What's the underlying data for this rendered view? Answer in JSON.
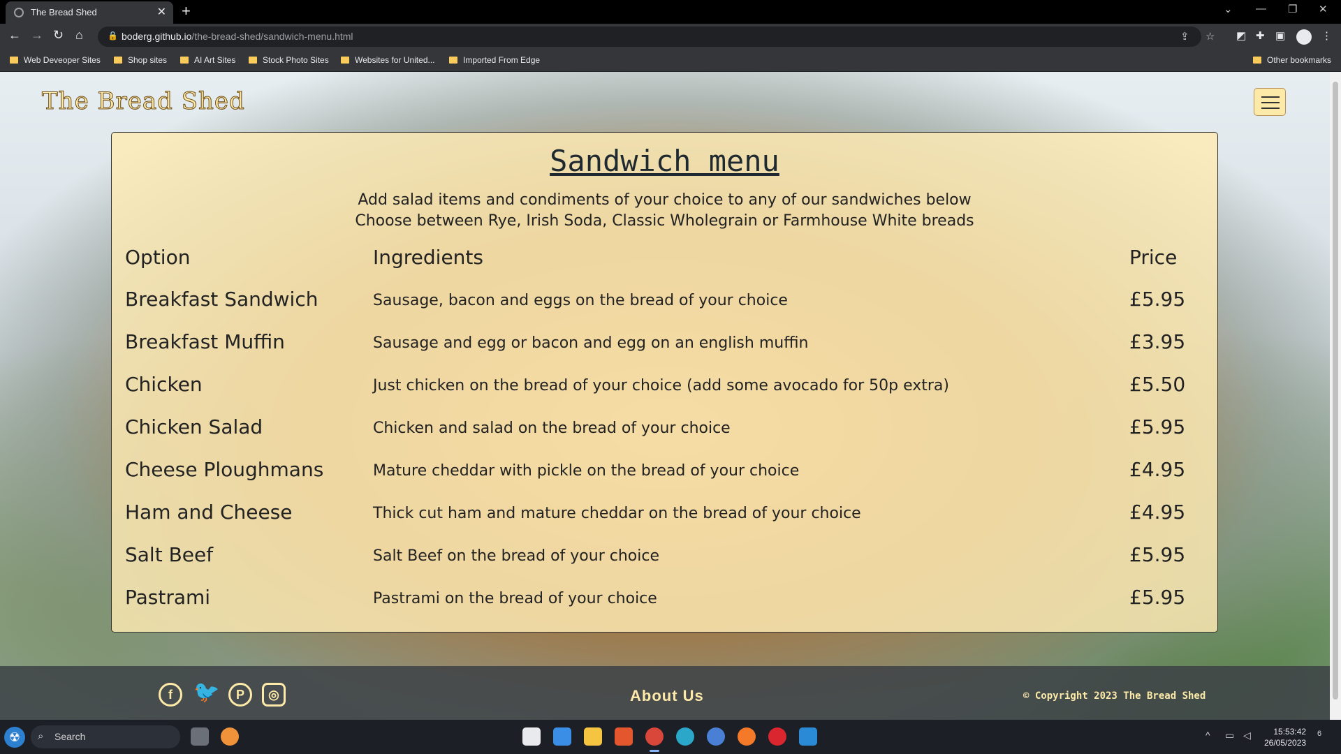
{
  "browser": {
    "tab_title": "The Bread Shed",
    "new_tab": "+",
    "url_host": "boderg.github.io",
    "url_path": "/the-bread-shed/sandwich-menu.html",
    "bookmarks": [
      "Web Deveoper Sites",
      "Shop sites",
      "AI Art Sites",
      "Stock Photo Sites",
      "Websites for United...",
      "Imported From Edge"
    ],
    "other_bookmarks": "Other bookmarks"
  },
  "site": {
    "brand": "The Bread Shed",
    "menu": {
      "title": "Sandwich menu",
      "subtitle_1": "Add salad items and condiments of your choice to any of our sandwiches below",
      "subtitle_2": "Choose between Rye, Irish Soda, Classic Wholegrain or Farmhouse White breads",
      "headers": {
        "option": "Option",
        "ingredients": "Ingredients",
        "price": "Price"
      },
      "rows": [
        {
          "option": "Breakfast Sandwich",
          "ingredients": "Sausage, bacon and eggs on the bread of your choice",
          "price": "£5.95"
        },
        {
          "option": "Breakfast Muffin",
          "ingredients": "Sausage and egg or bacon and egg on an english muffin",
          "price": "£3.95"
        },
        {
          "option": "Chicken",
          "ingredients": "Just chicken on the bread of your choice (add some avocado for 50p extra)",
          "price": "£5.50"
        },
        {
          "option": "Chicken Salad",
          "ingredients": "Chicken and salad on the bread of your choice",
          "price": "£5.95"
        },
        {
          "option": "Cheese Ploughmans",
          "ingredients": "Mature cheddar with pickle on the bread of your choice",
          "price": "£4.95"
        },
        {
          "option": "Ham and Cheese",
          "ingredients": "Thick cut ham and mature cheddar on the bread of your choice",
          "price": "£4.95"
        },
        {
          "option": "Salt Beef",
          "ingredients": "Salt Beef on the bread of your choice",
          "price": "£5.95"
        },
        {
          "option": "Pastrami",
          "ingredients": "Pastrami on the bread of your choice",
          "price": "£5.95"
        }
      ]
    },
    "footer": {
      "social_icons": [
        "facebook-icon",
        "twitter-icon",
        "pinterest-icon",
        "instagram-icon"
      ],
      "about": "About Us",
      "copyright": "© Copyright 2023 The Bread Shed"
    }
  },
  "taskbar": {
    "search_label": "Search",
    "time": "15:53:42",
    "date": "26/05/2023",
    "notification_count": "6"
  },
  "colors": {
    "brand_cream": "#fde9a8",
    "card_bg": "#ffecb5",
    "footer_bg": "#3c4146"
  }
}
